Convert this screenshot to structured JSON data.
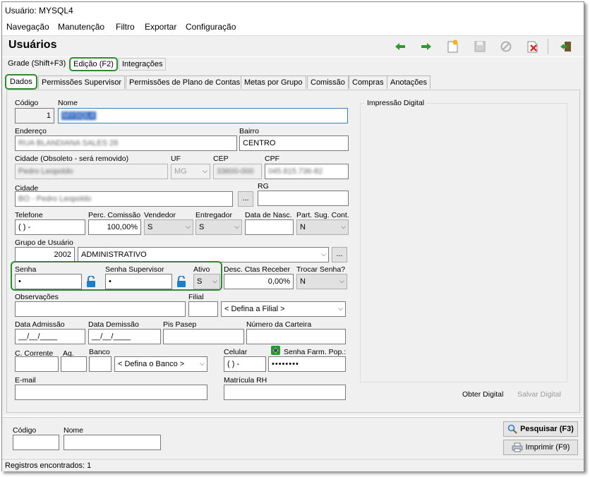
{
  "window": {
    "title": "Usuário: MYSQL4"
  },
  "menu": [
    "Navegação",
    "Manutenção",
    "Filtro",
    "Exportar",
    "Configuração"
  ],
  "header": {
    "title": "Usuários"
  },
  "toolbar": {
    "icons": [
      "arrow-left-icon",
      "arrow-right-icon",
      "new-icon",
      "save-icon",
      "cancel-icon",
      "delete-icon",
      "exit-icon"
    ],
    "colors": {
      "arrows": "#2e9a2e",
      "delete": "#d62a2a"
    }
  },
  "top_tabs": [
    "Grade (Shift+F3)",
    "Edição (F2)",
    "Integrações"
  ],
  "sub_tabs": [
    "Dados",
    "Permissões Supervisor",
    "Permissões de Plano de Contas",
    "Metas por Grupo",
    "Comissão",
    "Compras",
    "Anotações"
  ],
  "form": {
    "codigo": {
      "label": "Código",
      "value": "1"
    },
    "nome": {
      "label": "Nome",
      "value": "MYSQL4"
    },
    "endereco": {
      "label": "Endereço",
      "value": "RUA BLANDIANA SALES 28"
    },
    "bairro": {
      "label": "Bairro",
      "value": "CENTRO"
    },
    "cidade_obsoleto": {
      "label": "Cidade (Obsoleto - será removido)",
      "value": "Pedro Leopoldo"
    },
    "uf": {
      "label": "UF",
      "value": "MG"
    },
    "cep": {
      "label": "CEP",
      "value": "33600-000"
    },
    "cpf": {
      "label": "CPF",
      "value": "045.815.736-82"
    },
    "cidade": {
      "label": "Cidade",
      "value": "BO - Pedro Leopoldo"
    },
    "rg": {
      "label": "RG",
      "value": ""
    },
    "telefone": {
      "label": "Telefone",
      "value": "(  )    -"
    },
    "perc_comissao": {
      "label": "Perc. Comissão",
      "value": "100,00%"
    },
    "vendedor": {
      "label": "Vendedor",
      "value": "S"
    },
    "entregador": {
      "label": "Entregador",
      "value": "S"
    },
    "data_nasc": {
      "label": "Data de Nasc.",
      "value": ""
    },
    "part_sug_cont": {
      "label": "Part. Sug. Cont.",
      "value": "N"
    },
    "grupo_usuario": {
      "label": "Grupo de Usuário",
      "code": "2002",
      "value": "ADMINISTRATIVO"
    },
    "senha": {
      "label": "Senha",
      "value": "•"
    },
    "senha_supervisor": {
      "label": "Senha Supervisor",
      "value": "•"
    },
    "ativo": {
      "label": "Ativo",
      "value": "S"
    },
    "desc_ctas_receber": {
      "label": "Desc. Ctas Receber",
      "value": "0,00%"
    },
    "trocar_senha": {
      "label": "Trocar Senha?",
      "value": "N"
    },
    "observacoes": {
      "label": "Observações",
      "value": ""
    },
    "filial": {
      "label": "Filial",
      "value": "",
      "select": "< Defina a Filial >"
    },
    "data_admissao": {
      "label": "Data Admissão",
      "value": "__/__/____"
    },
    "data_demissao": {
      "label": "Data Demissão",
      "value": "__/__/____"
    },
    "pis_pasep": {
      "label": "Pis Pasep",
      "value": ""
    },
    "numero_carteira": {
      "label": "Número da Carteira",
      "value": ""
    },
    "c_corrente": {
      "label": "C. Corrente",
      "value": ""
    },
    "ag": {
      "label": "Ag.",
      "value": ""
    },
    "banco": {
      "label": "Banco",
      "value": "",
      "select": "< Defina o Banco >"
    },
    "celular": {
      "label": "Celular",
      "value": "(  )    -"
    },
    "senha_farm_pop": {
      "label": "Senha Farm. Pop.:",
      "value": "••••••••"
    },
    "email": {
      "label": "E-mail",
      "value": ""
    },
    "matricula_rh": {
      "label": "Matrícula RH",
      "value": ""
    }
  },
  "fingerprint": {
    "title": "Impressão Digital",
    "obter": "Obter Digital",
    "salvar": "Salvar Digital"
  },
  "search": {
    "codigo_label": "Código",
    "nome_label": "Nome",
    "pesquisar": "Pesquisar (F3)",
    "imprimir": "Imprimir (F9)"
  },
  "status": "Registros encontrados: 1",
  "highlight_color": "#2e8b2e"
}
